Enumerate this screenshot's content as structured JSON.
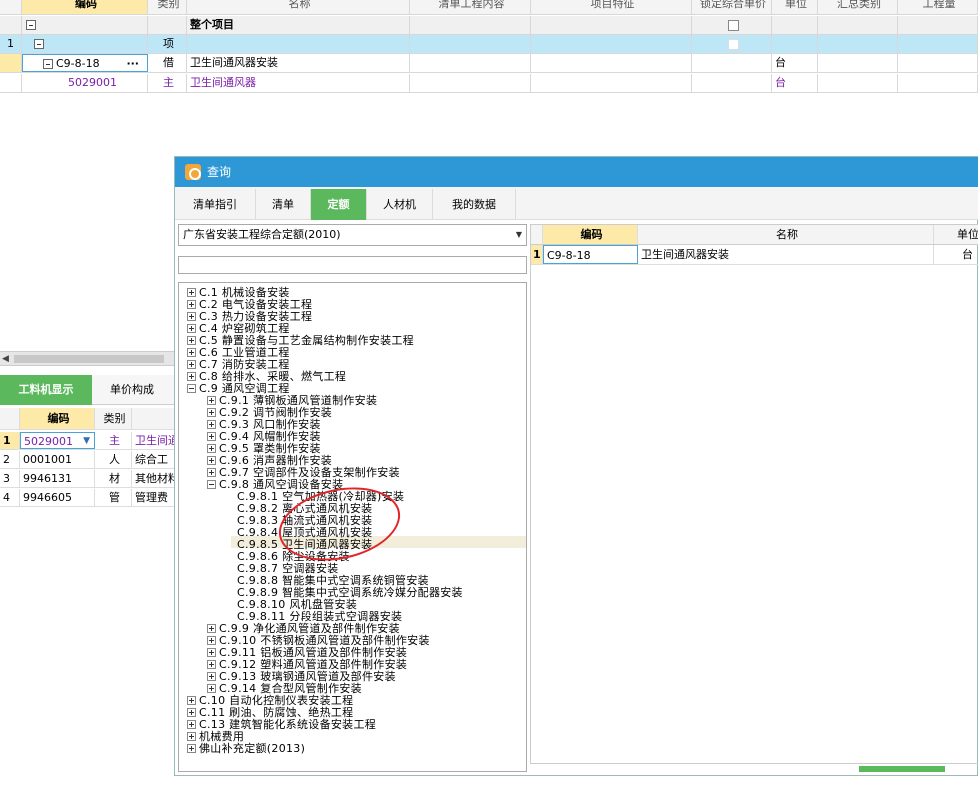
{
  "top_grid": {
    "headers": [
      "编码",
      "类别",
      "名称",
      "清单工程内容",
      "项目特征",
      "锁定综合单价",
      "单位",
      "汇总类别",
      "工程量"
    ],
    "rows": [
      {
        "no": "",
        "code": "",
        "type": "",
        "name": "整个项目",
        "unit": ""
      },
      {
        "no": "1",
        "code": "",
        "type": "项",
        "name": "",
        "unit": ""
      },
      {
        "no": "",
        "code": "C9-8-18",
        "type": "借",
        "name": "卫生间通风器安装",
        "unit": "台",
        "more": "···"
      },
      {
        "no": "",
        "code": "5029001",
        "type": "主",
        "name": "卫生间通风器",
        "unit": "台"
      }
    ]
  },
  "left_panel": {
    "tabs": [
      "工料机显示",
      "单价构成"
    ],
    "headers": [
      "编码",
      "类别"
    ],
    "rows": [
      {
        "no": "1",
        "code": "5029001",
        "type": "主",
        "name": "卫生间通"
      },
      {
        "no": "2",
        "code": "0001001",
        "type": "人",
        "name": "综合工"
      },
      {
        "no": "3",
        "code": "9946131",
        "type": "材",
        "name": "其他材料"
      },
      {
        "no": "4",
        "code": "9946605",
        "type": "管",
        "name": "管理费"
      }
    ]
  },
  "dialog": {
    "title": "查询",
    "tabs": [
      "清单指引",
      "清单",
      "定额",
      "人材机",
      "我的数据"
    ],
    "active_tab": "定额",
    "library": "广东省安装工程综合定额(2010)",
    "search_value": "",
    "tree": [
      {
        "label": "C.1 机械设备安装",
        "level": 0,
        "state": "plus"
      },
      {
        "label": "C.2 电气设备安装工程",
        "level": 0,
        "state": "plus"
      },
      {
        "label": "C.3 热力设备安装工程",
        "level": 0,
        "state": "plus"
      },
      {
        "label": "C.4 炉窑砌筑工程",
        "level": 0,
        "state": "plus"
      },
      {
        "label": "C.5 静置设备与工艺金属结构制作安装工程",
        "level": 0,
        "state": "plus"
      },
      {
        "label": "C.6 工业管道工程",
        "level": 0,
        "state": "plus"
      },
      {
        "label": "C.7 消防安装工程",
        "level": 0,
        "state": "plus"
      },
      {
        "label": "C.8 给排水、采暖、燃气工程",
        "level": 0,
        "state": "plus"
      },
      {
        "label": "C.9 通风空调工程",
        "level": 0,
        "state": "minus"
      },
      {
        "label": "C.9.1 薄钢板通风管道制作安装",
        "level": 1,
        "state": "plus"
      },
      {
        "label": "C.9.2 调节阀制作安装",
        "level": 1,
        "state": "plus"
      },
      {
        "label": "C.9.3 风口制作安装",
        "level": 1,
        "state": "plus"
      },
      {
        "label": "C.9.4 风帽制作安装",
        "level": 1,
        "state": "plus"
      },
      {
        "label": "C.9.5 罩类制作安装",
        "level": 1,
        "state": "plus"
      },
      {
        "label": "C.9.6 消声器制作安装",
        "level": 1,
        "state": "plus"
      },
      {
        "label": "C.9.7 空调部件及设备支架制作安装",
        "level": 1,
        "state": "plus"
      },
      {
        "label": "C.9.8 通风空调设备安装",
        "level": 1,
        "state": "minus"
      },
      {
        "label": "C.9.8.1 空气加热器(冷却器)安装",
        "level": 2,
        "state": "none"
      },
      {
        "label": "C.9.8.2 离心式通风机安装",
        "level": 2,
        "state": "none"
      },
      {
        "label": "C.9.8.3 轴流式通风机安装",
        "level": 2,
        "state": "none"
      },
      {
        "label": "C.9.8.4 屋顶式通风机安装",
        "level": 2,
        "state": "none"
      },
      {
        "label": "C.9.8.5 卫生间通风器安装",
        "level": 2,
        "state": "none"
      },
      {
        "label": "C.9.8.6 除尘设备安装",
        "level": 2,
        "state": "none"
      },
      {
        "label": "C.9.8.7 空调器安装",
        "level": 2,
        "state": "none"
      },
      {
        "label": "C.9.8.8 智能集中式空调系统铜管安装",
        "level": 2,
        "state": "none"
      },
      {
        "label": "C.9.8.9 智能集中式空调系统冷媒分配器安装",
        "level": 2,
        "state": "none"
      },
      {
        "label": "C.9.8.10 风机盘管安装",
        "level": 2,
        "state": "none"
      },
      {
        "label": "C.9.8.11 分段组装式空调器安装",
        "level": 2,
        "state": "none"
      },
      {
        "label": "C.9.9 净化通风管道及部件制作安装",
        "level": 1,
        "state": "plus"
      },
      {
        "label": "C.9.10 不锈钢板通风管道及部件制作安装",
        "level": 1,
        "state": "plus"
      },
      {
        "label": "C.9.11 铝板通风管道及部件制作安装",
        "level": 1,
        "state": "plus"
      },
      {
        "label": "C.9.12 塑料通风管道及部件制作安装",
        "level": 1,
        "state": "plus"
      },
      {
        "label": "C.9.13 玻璃钢通风管道及部件安装",
        "level": 1,
        "state": "plus"
      },
      {
        "label": "C.9.14 复合型风管制作安装",
        "level": 1,
        "state": "plus"
      },
      {
        "label": "C.10 自动化控制仪表安装工程",
        "level": 0,
        "state": "plus"
      },
      {
        "label": "C.11 刷油、防腐蚀、绝热工程",
        "level": 0,
        "state": "plus"
      },
      {
        "label": "C.13 建筑智能化系统设备安装工程",
        "level": 0,
        "state": "plus"
      },
      {
        "label": "机械费用",
        "level": 0,
        "state": "plus"
      },
      {
        "label": "佛山补充定额(2013)",
        "level": 0,
        "state": "plus"
      }
    ],
    "results": {
      "headers": [
        "编码",
        "名称",
        "单位"
      ],
      "rows": [
        {
          "no": "1",
          "code": "C9-8-18",
          "name": "卫生间通风器安装",
          "unit": "台"
        }
      ]
    }
  },
  "colors": {
    "accent_green": "#5cb85c",
    "title_blue": "#2e97d6",
    "highlight_red": "#e0262a",
    "header_yellow": "#fde9a8"
  }
}
